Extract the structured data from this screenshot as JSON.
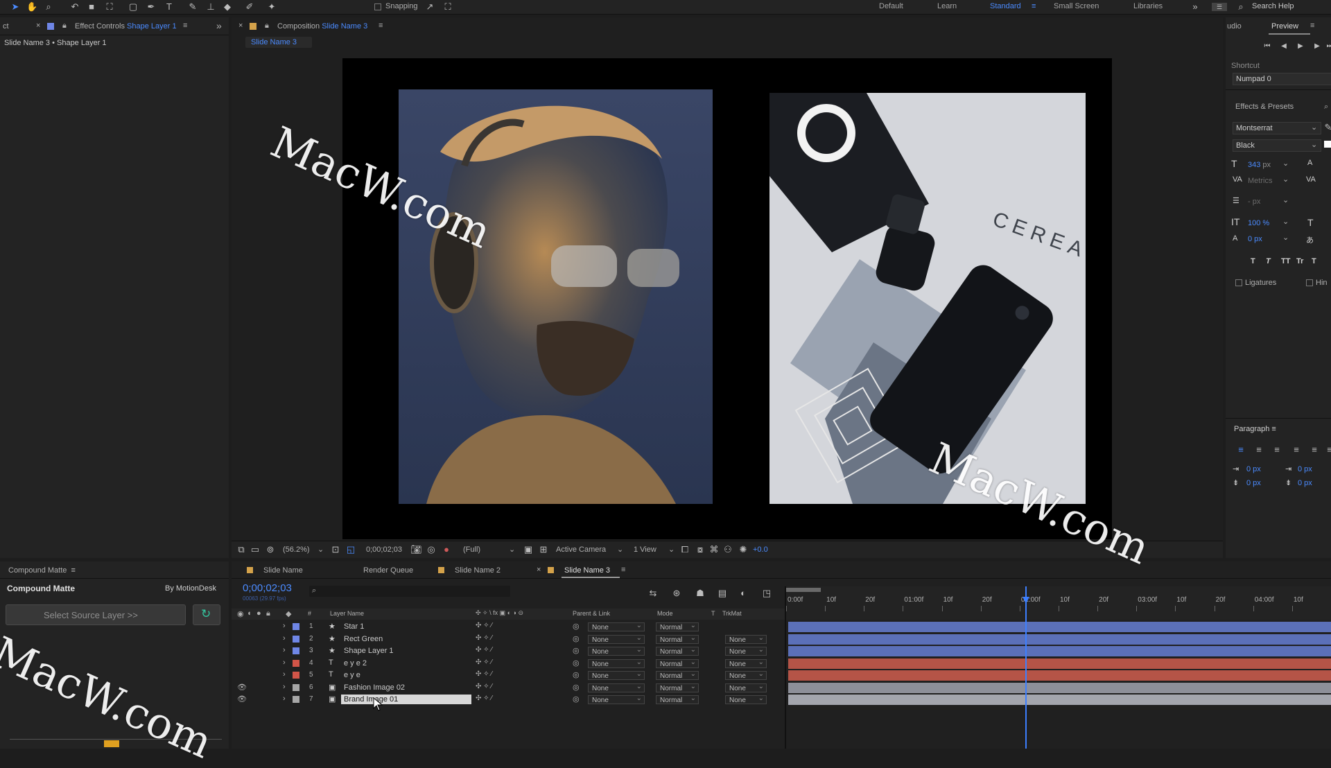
{
  "toolbar": {
    "snapping_label": "Snapping",
    "workspaces": [
      {
        "label": "Default",
        "active": false
      },
      {
        "label": "Learn",
        "active": false
      },
      {
        "label": "Standard",
        "active": true
      },
      {
        "label": "Small Screen",
        "active": false
      },
      {
        "label": "Libraries",
        "active": false
      }
    ],
    "search_help": "Search Help"
  },
  "effect_controls": {
    "tab_prefix": "ct",
    "tab_label": "Effect Controls",
    "tab_target": "Shape Layer 1",
    "breadcrumb": "Slide Name 3 • Shape Layer 1"
  },
  "composition": {
    "tab_label": "Composition",
    "tab_target": "Slide Name 3",
    "sub_tab": "Slide Name 3",
    "zoom": "(56.2%)",
    "timecode": "0;00;02;03",
    "resolution": "(Full)",
    "camera": "Active Camera",
    "views": "1 View",
    "exposure": "+0.0"
  },
  "right_panel": {
    "audio_tab": "udio",
    "preview_tab": "Preview",
    "shortcut_label": "Shortcut",
    "shortcut_value": "Numpad 0",
    "effects_presets": "Effects & Presets",
    "font_family": "Montserrat",
    "font_style": "Black",
    "font_size": "343",
    "font_unit": "px",
    "kerning": "Metrics",
    "leading": "- px",
    "vscale": "100 %",
    "baseline": "0 px",
    "style_glyphs": [
      "T",
      "T",
      "TT",
      "Tr",
      "T"
    ],
    "ligatures": "Ligatures",
    "hindi": "Hin",
    "paragraph": "Paragraph",
    "indent_values": [
      "0 px",
      "0 px",
      "0 px",
      "0 px"
    ]
  },
  "compound_matte": {
    "panel_tab": "Compound Matte",
    "title": "Compound Matte",
    "author": "By MotionDesk",
    "select_layer": "Select Source Layer >>"
  },
  "timeline": {
    "tabs": [
      {
        "label": "Slide Name",
        "active": false
      },
      {
        "label": "Render Queue",
        "active": false
      },
      {
        "label": "Slide Name 2",
        "active": false
      },
      {
        "label": "Slide Name 3",
        "active": true
      }
    ],
    "timecode": "0;00;02;03",
    "frames": "00063 (29.97 fps)",
    "headers": {
      "num": "#",
      "layer_name": "Layer Name",
      "parent": "Parent & Link",
      "mode": "Mode",
      "t": "T",
      "trkmat": "TrkMat"
    },
    "ruler": [
      "0:00f",
      "10f",
      "20f",
      "01:00f",
      "10f",
      "20f",
      "02:00f",
      "10f",
      "20f",
      "03:00f",
      "10f",
      "20f",
      "04:00f",
      "10f"
    ],
    "playhead_fraction": 0.437,
    "layers": [
      {
        "num": "1",
        "type_icon": "★",
        "name": "Star 1",
        "color": "#6f86e6",
        "parent": "None",
        "mode": "Normal",
        "trkmat": "",
        "visible": false,
        "bar_color": "#5b70b8"
      },
      {
        "num": "2",
        "type_icon": "★",
        "name": "Rect Green",
        "color": "#6f86e6",
        "parent": "None",
        "mode": "Normal",
        "trkmat": "None",
        "visible": false,
        "bar_color": "#5b70b8"
      },
      {
        "num": "3",
        "type_icon": "★",
        "name": "Shape Layer 1",
        "color": "#6f86e6",
        "parent": "None",
        "mode": "Normal",
        "trkmat": "None",
        "visible": false,
        "bar_color": "#5b70b8"
      },
      {
        "num": "4",
        "type_icon": "T",
        "name": "e y e 2",
        "color": "#d25548",
        "parent": "None",
        "mode": "Normal",
        "trkmat": "None",
        "visible": false,
        "bar_color": "#b55447"
      },
      {
        "num": "5",
        "type_icon": "T",
        "name": "e y e",
        "color": "#d25548",
        "parent": "None",
        "mode": "Normal",
        "trkmat": "None",
        "visible": false,
        "bar_color": "#b55447"
      },
      {
        "num": "6",
        "type_icon": "▣",
        "name": "Fashion Image 02",
        "color": "#a7a7a7",
        "parent": "None",
        "mode": "Normal",
        "trkmat": "None",
        "visible": true,
        "bar_color": "#8d8f99"
      },
      {
        "num": "7",
        "type_icon": "▣",
        "name": "Brand Image 01",
        "color": "#a7a7a7",
        "parent": "None",
        "mode": "Normal",
        "trkmat": "None",
        "visible": true,
        "bar_color": "#a3a5ad",
        "selected": true
      }
    ]
  },
  "watermark": "MacW.com"
}
